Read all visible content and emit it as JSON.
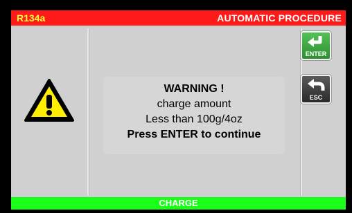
{
  "header": {
    "refrigerant": "R134a",
    "procedure": "AUTOMATIC PROCEDURE"
  },
  "message": {
    "line1": "WARNING !",
    "line2": "charge amount",
    "line3": "Less than 100g/4oz",
    "line4": "Press ENTER to continue"
  },
  "buttons": {
    "enter_label": "ENTER",
    "esc_label": "ESC"
  },
  "footer": {
    "label": "CHARGE"
  },
  "colors": {
    "header_bg": "#ff1a1a",
    "footer_bg": "#1aff1a",
    "enter_bg": "#3aa43d",
    "esc_bg": "#3a3a3a",
    "warning_yellow": "#ffee00"
  },
  "icons": {
    "warning": "warning-triangle-icon",
    "enter": "enter-return-icon",
    "esc": "back-arrow-icon"
  }
}
